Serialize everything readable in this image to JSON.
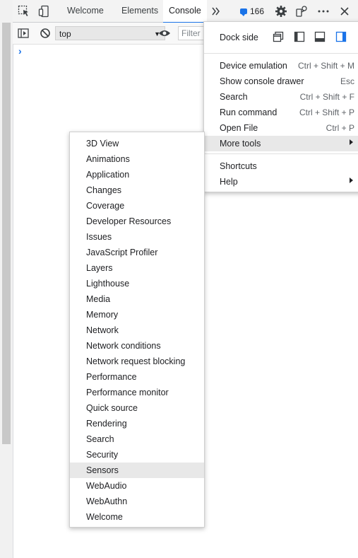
{
  "toolbar": {
    "tabs": [
      "Welcome",
      "Elements",
      "Console"
    ],
    "active_tab": "Console",
    "issues_count": "166",
    "accent_color": "#1a73e8"
  },
  "console_bar": {
    "context": "top",
    "filter_placeholder": "Filter",
    "prompt": "›"
  },
  "main_menu": {
    "dock_side_label": "Dock side",
    "items": [
      {
        "label": "Device emulation",
        "shortcut": "Ctrl + Shift + M"
      },
      {
        "label": "Show console drawer",
        "shortcut": "Esc"
      },
      {
        "label": "Search",
        "shortcut": "Ctrl + Shift + F"
      },
      {
        "label": "Run command",
        "shortcut": "Ctrl + Shift + P"
      },
      {
        "label": "Open File",
        "shortcut": "Ctrl + P"
      },
      {
        "label": "More tools",
        "shortcut": ""
      }
    ],
    "items2": [
      {
        "label": "Shortcuts"
      },
      {
        "label": "Help"
      }
    ]
  },
  "more_tools": {
    "items": [
      "3D View",
      "Animations",
      "Application",
      "Changes",
      "Coverage",
      "Developer Resources",
      "Issues",
      "JavaScript Profiler",
      "Layers",
      "Lighthouse",
      "Media",
      "Memory",
      "Network",
      "Network conditions",
      "Network request blocking",
      "Performance",
      "Performance monitor",
      "Quick source",
      "Rendering",
      "Search",
      "Security",
      "Sensors",
      "WebAudio",
      "WebAuthn",
      "Welcome"
    ],
    "highlighted": "Sensors"
  }
}
